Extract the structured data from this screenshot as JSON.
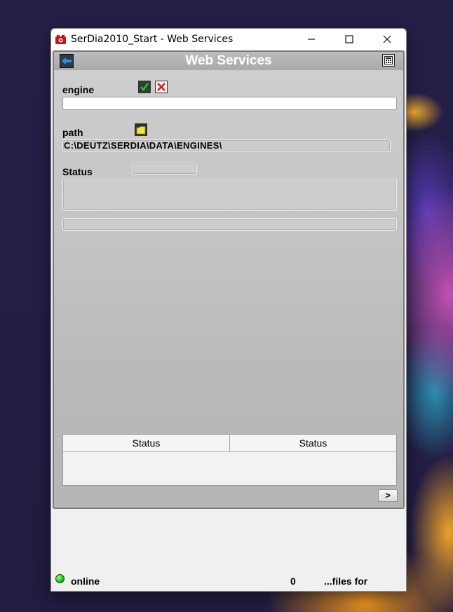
{
  "window": {
    "title": "SerDia2010_Start - Web Services",
    "app_icon": "serdia-app-icon",
    "controls": {
      "minimize": "—",
      "maximize": "☐",
      "close": "✕"
    }
  },
  "panel": {
    "title": "Web Services",
    "back_icon": "back-arrow-icon",
    "calc_icon": "calculator-icon"
  },
  "engine": {
    "label": "engine",
    "value": "",
    "ok_icon": "check-icon",
    "cancel_icon": "red-x-icon"
  },
  "path": {
    "label": "path",
    "value": "C:\\DEUTZ\\SERDIA\\DATA\\ENGINES\\",
    "folder_icon": "folder-icon"
  },
  "status": {
    "label": "Status",
    "value": "",
    "message": "",
    "progress": 0
  },
  "table": {
    "columns": [
      "Status",
      "Status"
    ],
    "rows": []
  },
  "next_label": ">",
  "statusbar": {
    "connection": "online",
    "count": "0",
    "files_label": "...files for"
  },
  "colors": {
    "panel_bg": "#c7c7c7",
    "title_text": "#ffffff",
    "led": "#1fc51f",
    "cancel_red": "#e01b1b",
    "ok_green": "#2aa02a"
  }
}
